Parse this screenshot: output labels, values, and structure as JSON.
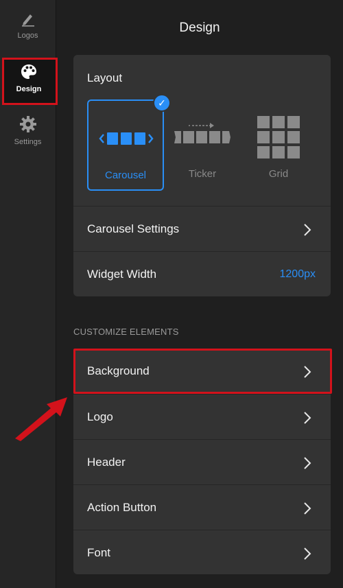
{
  "nav": {
    "items": [
      {
        "label": "Logos",
        "icon": "pen-icon"
      },
      {
        "label": "Design",
        "icon": "palette-icon",
        "active": true
      },
      {
        "label": "Settings",
        "icon": "gear-icon"
      }
    ]
  },
  "panel": {
    "title": "Design"
  },
  "layout": {
    "title": "Layout",
    "options": [
      {
        "label": "Carousel",
        "selected": true
      },
      {
        "label": "Ticker",
        "selected": false
      },
      {
        "label": "Grid",
        "selected": false
      }
    ],
    "carousel_settings_label": "Carousel Settings",
    "widget_width_label": "Widget Width",
    "widget_width_value": "1200px"
  },
  "customize": {
    "section_label": "CUSTOMIZE ELEMENTS",
    "items": [
      {
        "label": "Background"
      },
      {
        "label": "Logo"
      },
      {
        "label": "Header"
      },
      {
        "label": "Action Button"
      },
      {
        "label": "Font"
      }
    ]
  },
  "colors": {
    "accent": "#2a8ff7",
    "highlight": "#d3121b",
    "card": "#333333",
    "background": "#1f1f1f"
  }
}
